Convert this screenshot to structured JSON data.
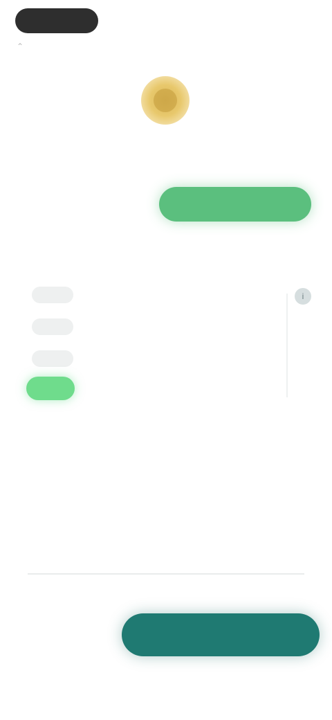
{
  "top_bar": {
    "back_label": "",
    "right_label": ""
  },
  "order": {
    "title": "",
    "status_label": "",
    "status_badge": ""
  },
  "timeline": {
    "section_title": "",
    "items": [
      {
        "pill": "",
        "text": ""
      },
      {
        "pill": "",
        "text": ""
      },
      {
        "pill": "",
        "text": ""
      },
      {
        "pill": "",
        "text": ""
      }
    ]
  },
  "summary": {
    "section_title": "",
    "rows": [
      {
        "label": "",
        "value": ""
      },
      {
        "label": "",
        "value": ""
      }
    ],
    "total": {
      "label": "",
      "value": ""
    }
  },
  "bottom": {
    "note": "",
    "secondary_label": "",
    "primary_label": ""
  },
  "colors": {
    "accent_green": "#5bbf7e",
    "primary_teal": "#1f7a72",
    "medal_gold": "#d9b65a"
  }
}
